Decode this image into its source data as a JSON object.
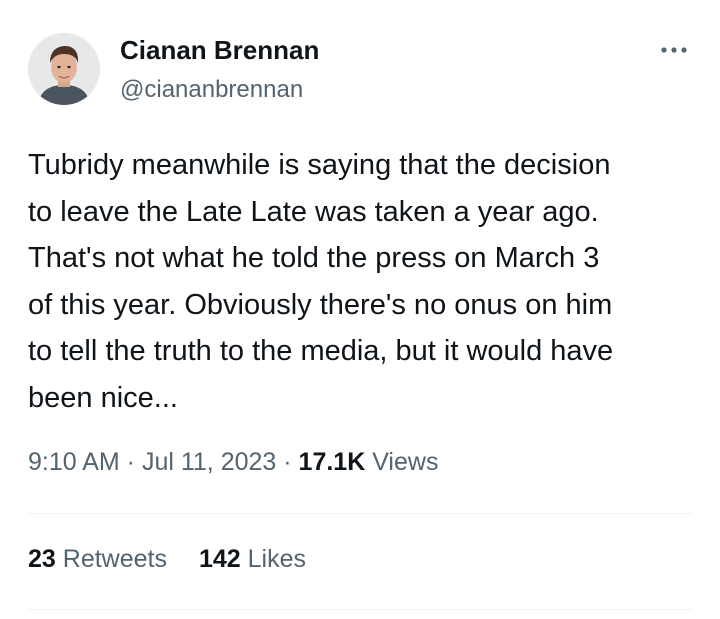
{
  "author": {
    "display_name": "Cianan Brennan",
    "handle": "@ciananbrennan",
    "avatar_icon": "person-avatar"
  },
  "more_icon": "more-horizontal-icon",
  "tweet": {
    "text_lines": [
      "Tubridy meanwhile is saying that the decision",
      "to leave the Late Late was taken a year ago.",
      "That's not what he told the press on March 3",
      "of this year. Obviously there's no onus on him",
      "to tell the truth to the media, but it would have",
      "been nice..."
    ]
  },
  "meta": {
    "time": "9:10 AM",
    "sep1": " · ",
    "date": "Jul 11, 2023",
    "sep2": " · ",
    "views_count": "17.1K",
    "views_label": " Views"
  },
  "stats": {
    "retweets_count": "23",
    "retweets_label": " Retweets",
    "likes_count": "142",
    "likes_label": " Likes"
  },
  "colors": {
    "text_primary": "#0f1419",
    "text_secondary": "#536471",
    "divider": "#eff3f4"
  }
}
